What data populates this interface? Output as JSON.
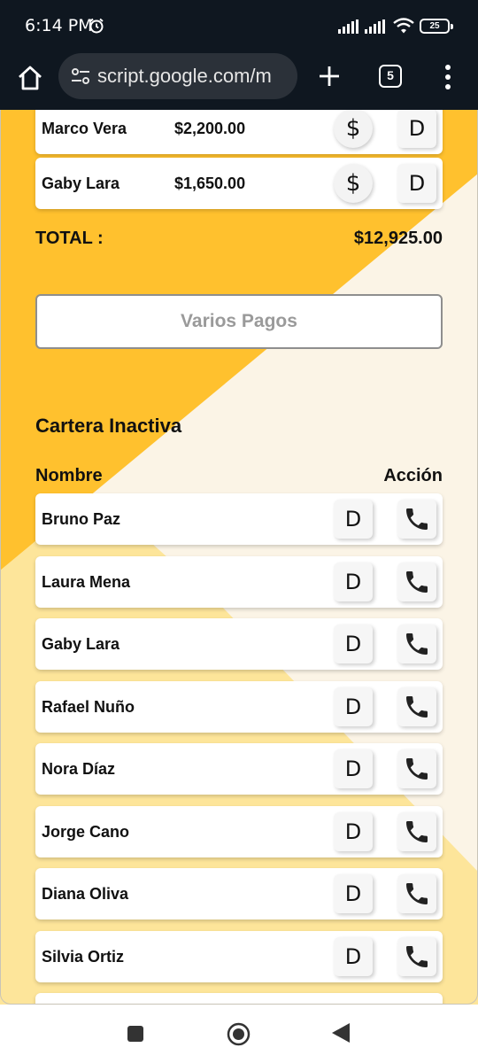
{
  "status_bar": {
    "time": "6:14 PM",
    "battery": "25"
  },
  "browser": {
    "url": "script.google.com/m",
    "tab_count": "5"
  },
  "active_list": [
    {
      "name": "Marco Vera",
      "amount": "$2,200.00",
      "pay_label": "$",
      "d_label": "D"
    },
    {
      "name": "Gaby Lara",
      "amount": "$1,650.00",
      "pay_label": "$",
      "d_label": "D"
    }
  ],
  "total": {
    "label": "TOTAL :",
    "value": "$12,925.00"
  },
  "varios_pagos_label": "Varios Pagos",
  "inactive": {
    "title": "Cartera Inactiva",
    "col_name": "Nombre",
    "col_action": "Acción",
    "d_label": "D",
    "items": [
      {
        "name": "Bruno Paz"
      },
      {
        "name": "Laura Mena"
      },
      {
        "name": "Gaby Lara"
      },
      {
        "name": "Rafael Nuño"
      },
      {
        "name": "Nora Díaz"
      },
      {
        "name": "Jorge Cano"
      },
      {
        "name": "Diana Oliva"
      },
      {
        "name": "Silvia Ortiz"
      }
    ]
  },
  "colors": {
    "yellow_primary": "#ffc12e",
    "yellow_light": "#fde59a",
    "cream": "#fbf4e6",
    "browser_bg": "#0f1720"
  },
  "icons": {
    "call": "phone-icon",
    "pay": "dollar-icon",
    "home": "home-icon",
    "tabs": "tabs-icon",
    "menu": "kebab-menu-icon"
  }
}
